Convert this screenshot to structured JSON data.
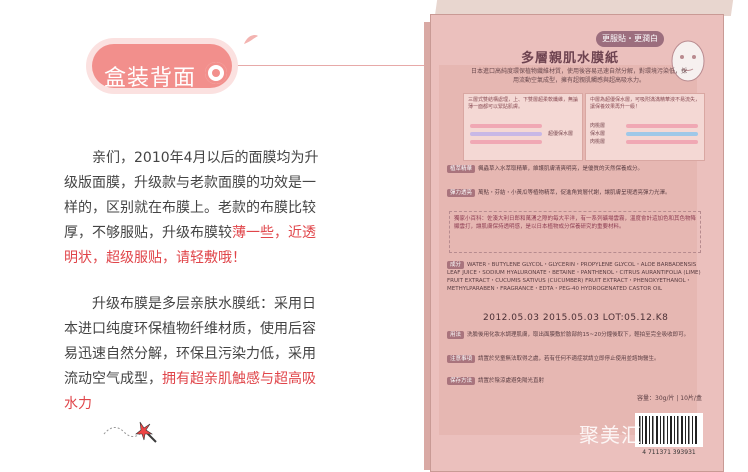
{
  "header": {
    "title": "盒装背面"
  },
  "paragraphs": {
    "p1_lines": [
      "亲们，2010年4月以后的面膜均为升",
      "级版面膜，升级款与老款面膜的功效是一",
      "样的，区别就在布膜上。老款的布膜比较",
      "厚，不够服贴，升级布膜较"
    ],
    "p1_highlight_a": "薄一些，近透",
    "p1_highlight_b": "明状，超级服贴，请轻敷哦！",
    "p2_lines": [
      "升级布膜是多层亲肤水膜纸：采用日",
      "本进口纯度环保植物纤维材质，使用后容",
      "易迅速自然分解，环保且污染力低，采用",
      "流动空气成型，"
    ],
    "p2_highlight_a": "拥有超亲肌触感与超高吸",
    "p2_highlight_b": "水力"
  },
  "box": {
    "badge": "更服貼・更潤白",
    "title": "多層親肌水膜紙",
    "intro": "日本進口高純度環保植物纖維材質，使用後容易迅速自然分解，對環境污染低，採用流動空氣成型，擁有超親肌觸感與超高吸水力。",
    "diag_left_label": "三層式雙結構處理，上、下雙層超柔軟纖維，無論薄一面都可以緊貼肌膚。",
    "diag_left_tag": "超優保水層",
    "diag_right_label": "中層為超優保水層，可吸附滿滿精華液不易流失，讓保養效果再升一級！",
    "diag_right_tags": [
      "肉桃層",
      "保水層",
      "肉桃層"
    ],
    "sections": [
      {
        "tag": "植萃精華",
        "text": "楓蟲草入水萃取精華，維護肌膚清爽明亮，是優質的天然保養成分。"
      },
      {
        "tag": "彈力透亮",
        "text": "萬點・芬結・小黃瓜等植物精萃，促進角質層代謝，讓肌膚呈現透亮彈力光澤。"
      }
    ],
    "special_note": "獨家小百科：佐湊大利日郎和萬湧之際的每大平洋，有一系列礦場雲霧，溫度會計這加色和其色物降顯雲打，讓肌膚保持透明感，是以日本植物成分保養研究的重要材料。",
    "ingredients_tag": "成分",
    "ingredients": "WATER・BUTYLENE GLYCOL・GLYCERIN・PROPYLENE GLYCOL・ALOE BARBADENSIS LEAF JUICE・SODIUM HYALURONATE・BETAINE・PANTHENOL・CITRUS AURANTIFOLIA (LIME) FRUIT EXTRACT・CUCUMIS SATIVUS (CUCUMBER) FRUIT EXTRACT・PHENOXYETHANOL・METHYLPARABEN・FRAGRANCE・EDTA・PEG-40 HYDROGENATED CASTOR OIL",
    "batch": "2012.05.03 2015.05.03  LOT:05.12.K8",
    "usage_tag": "用法",
    "usage": "洗臉後用化妝水調理肌膚，取出面膜敷於臉部約15~20分鐘後取下，輕拍至完全吸收即可。",
    "caution_tag": "注意事項",
    "caution": "請置於兒童無法取得之處，若有任何不適症狀請立即停止使用並諮詢醫生。",
    "storage_tag": "保存方法",
    "storage": "請置於陰涼處避免陽光直射",
    "weight": "容量：30g/片 | 10片/盒",
    "barcode_number": "4 711371 393931",
    "watermark": "聚美汇"
  }
}
